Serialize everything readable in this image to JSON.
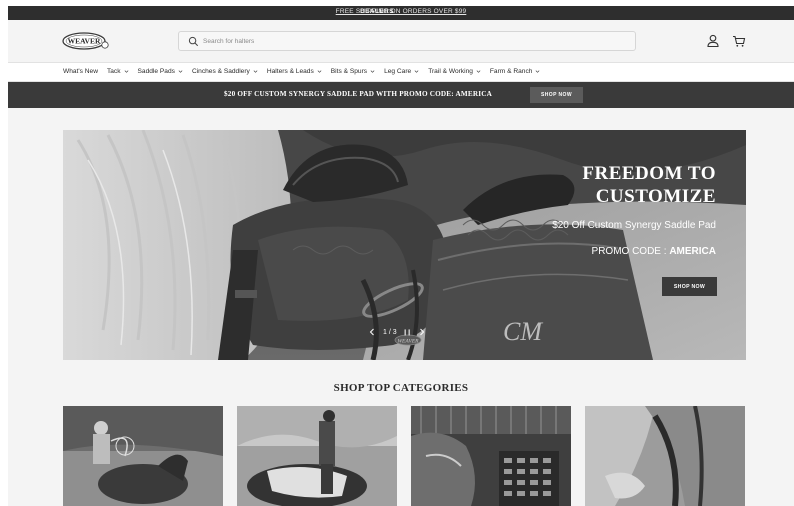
{
  "announcement": {
    "text": "FREE SHIPPING ON ORDERS OVER $99",
    "dealers": "DEALERS"
  },
  "header": {
    "logo_text": "WEAVER",
    "search_placeholder": "Search for halters"
  },
  "nav": {
    "items": [
      {
        "label": "What's New",
        "dropdown": false
      },
      {
        "label": "Tack",
        "dropdown": true
      },
      {
        "label": "Saddle Pads",
        "dropdown": true
      },
      {
        "label": "Cinches & Saddlery",
        "dropdown": true
      },
      {
        "label": "Halters & Leads",
        "dropdown": true
      },
      {
        "label": "Bits & Spurs",
        "dropdown": true
      },
      {
        "label": "Leg Care",
        "dropdown": true
      },
      {
        "label": "Trail & Working",
        "dropdown": true
      },
      {
        "label": "Farm & Ranch",
        "dropdown": true
      }
    ]
  },
  "promo": {
    "text": "$20 OFF CUSTOM SYNERGY SADDLE PAD WITH PROMO CODE: AMERICA",
    "button": "SHOP NOW"
  },
  "hero": {
    "title_line1": "FREEDOM TO",
    "title_line2": "CUSTOMIZE",
    "subtitle": "$20 Off Custom Synergy Saddle Pad",
    "code_label": "PROMO CODE : ",
    "code_value": "AMERICA",
    "button": "SHOP NOW",
    "pad_initials": "CM",
    "slide_counter": "1 / 3"
  },
  "categories": {
    "title": "SHOP TOP CATEGORIES"
  },
  "colors": {
    "dark_bar": "#2e2e2e",
    "promo_bar": "#3a3a3a",
    "page_bg": "#f4f4f4"
  }
}
